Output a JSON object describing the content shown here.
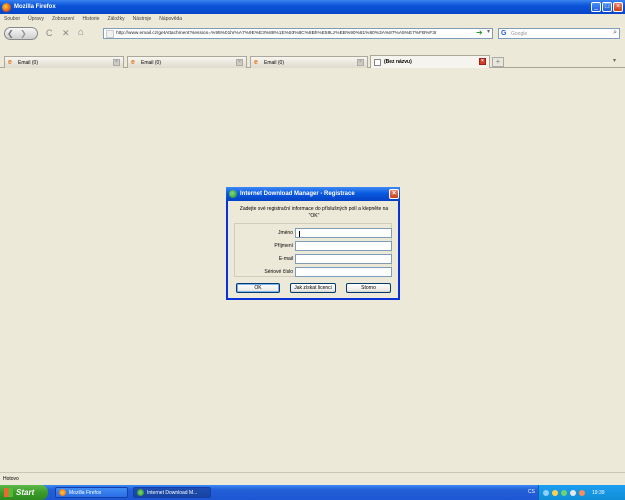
{
  "window": {
    "title": "Mozilla Firefox",
    "buttons": {
      "minimize": "_",
      "maximize": "□",
      "close": "×"
    }
  },
  "menu": [
    "Soubor",
    "Úpravy",
    "Zobrazení",
    "Historie",
    "Záložky",
    "Nástroje",
    "Nápověda"
  ],
  "navbar": {
    "back": "❮",
    "forward": "❯",
    "reload": "C",
    "stop": "✕",
    "home": "⌂",
    "url": "http://www.email.cz/getAttachment?session=%95%01hr%A7%9E%E3%88%1E%93%8C%8Bh%E59Lz%EB%90%81%80%3A%87%A5%E7%FB%F3r",
    "go": "➜",
    "dropdown": "▾",
    "search_placeholder": "Google",
    "search_engine_icon": "google-icon"
  },
  "tabs": [
    {
      "label": "Email (0)",
      "icon": "email-icon",
      "active": false
    },
    {
      "label": "Email (0)",
      "icon": "email-icon",
      "active": false
    },
    {
      "label": "Email (0)",
      "icon": "email-icon",
      "active": false
    },
    {
      "label": "(Bez názvu)",
      "icon": "blank-page-icon",
      "active": true
    }
  ],
  "tab_close": "×",
  "new_tab": "+",
  "tab_list": "▾",
  "dialog": {
    "title": "Internet Download Manager - Registrace",
    "close": "×",
    "message": "Zadejte své registrační informace do příslušných polí a klepněte na \"OK\"",
    "fields": [
      {
        "label": "Jméno",
        "value": ""
      },
      {
        "label": "Příjmení",
        "value": ""
      },
      {
        "label": "E-mail",
        "value": ""
      },
      {
        "label": "Sériové číslo",
        "value": ""
      }
    ],
    "buttons": {
      "ok": "OK",
      "license": "Jak získat licenci",
      "cancel": "Storno"
    }
  },
  "status": "Hotovo",
  "taskbar": {
    "start": "Start",
    "items": [
      {
        "label": "Mozilla Firefox",
        "active": false
      },
      {
        "label": "Internet Download M...",
        "active": true
      }
    ],
    "language": "CS",
    "clock": "19:39"
  },
  "colors": {
    "xp_blue": "#0a54d8",
    "window_bg": "#ece9d8",
    "start_green": "#3a9a29",
    "tray_blue": "#108ed6"
  }
}
